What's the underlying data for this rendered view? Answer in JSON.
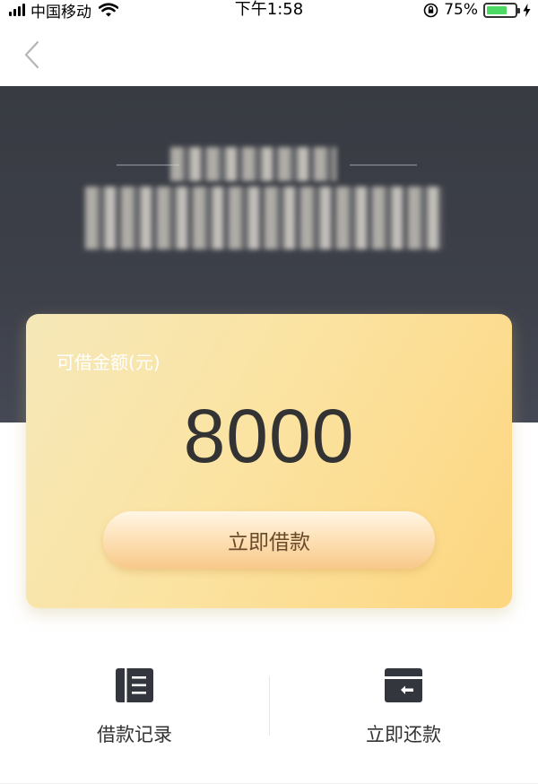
{
  "status_bar": {
    "carrier": "中国移动",
    "time": "下午1:58",
    "battery_percent": "75%",
    "battery_level": 0.75
  },
  "card": {
    "label": "可借金额(元)",
    "amount": "8000",
    "borrow_button_label": "立即借款"
  },
  "actions": [
    {
      "label": "借款记录",
      "icon": "list-document-icon"
    },
    {
      "label": "立即还款",
      "icon": "card-return-icon"
    }
  ],
  "colors": {
    "header_bg": "#3d4049",
    "card_gradient_start": "#f5e8b8",
    "card_gradient_end": "#fcd67f",
    "button_text": "#6a4a2a",
    "icon_dark": "#33363c"
  }
}
